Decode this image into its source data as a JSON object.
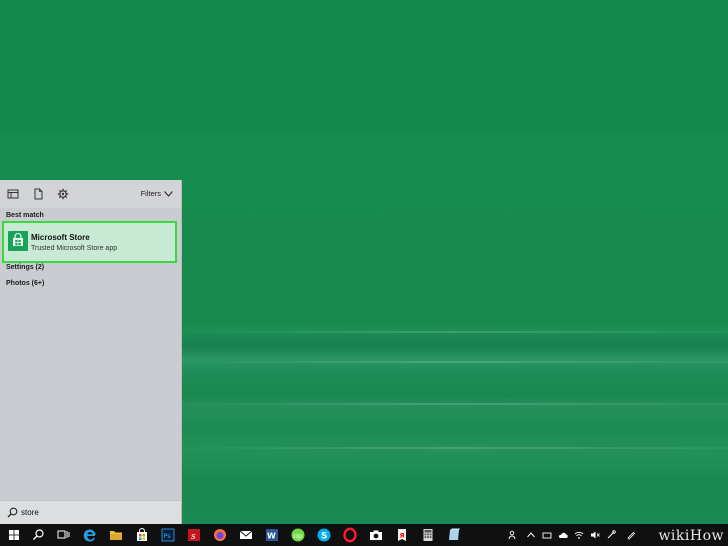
{
  "search_panel": {
    "filters_label": "Filters",
    "best_match_heading": "Best match",
    "best_match": {
      "title": "Microsoft Store",
      "subtitle": "Trusted Microsoft Store app"
    },
    "settings_label": "Settings (2)",
    "photos_label": "Photos (6+)"
  },
  "search": {
    "value": "store"
  },
  "watermark": {
    "text": "wikiHow"
  },
  "colors": {
    "desktop": "#14874c",
    "panel": "#c9ccd0",
    "highlight_border": "#39d93c",
    "highlight_fill": "#c8e9d4",
    "taskbar": "#101010"
  }
}
